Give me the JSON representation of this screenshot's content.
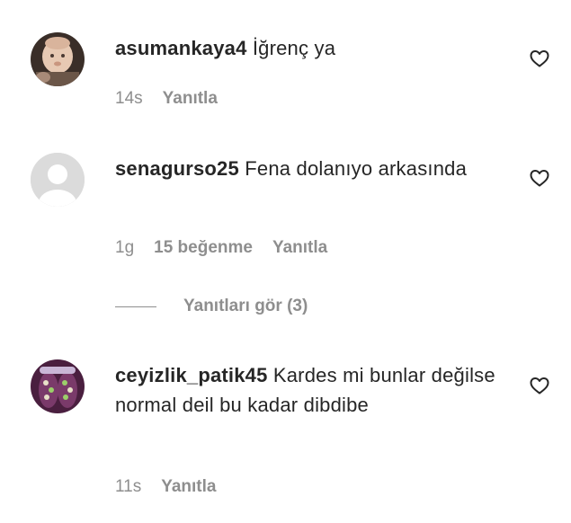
{
  "comments": [
    {
      "username": "asumankaya4",
      "text": "İğrenç ya",
      "time": "14s",
      "reply_label": "Yanıtla",
      "avatar": "baby-photo",
      "like_icon": "heart-outline-icon"
    },
    {
      "username": "senagurso25",
      "text": "Fena dolanıyo arkasında",
      "time": "1g",
      "likes": "15 beğenme",
      "reply_label": "Yanıtla",
      "avatar": "default-user",
      "like_icon": "heart-outline-icon",
      "view_replies": "Yanıtları gör (3)"
    },
    {
      "username": "ceyizlik_patik45",
      "text": "Kardes mi bunlar değilse normal deil bu kadar dibdibe",
      "time": "11s",
      "reply_label": "Yanıtla",
      "avatar": "patik-photo",
      "like_icon": "heart-outline-icon"
    }
  ],
  "colors": {
    "text": "#262626",
    "secondary": "#8e8e8e",
    "background": "#ffffff"
  }
}
